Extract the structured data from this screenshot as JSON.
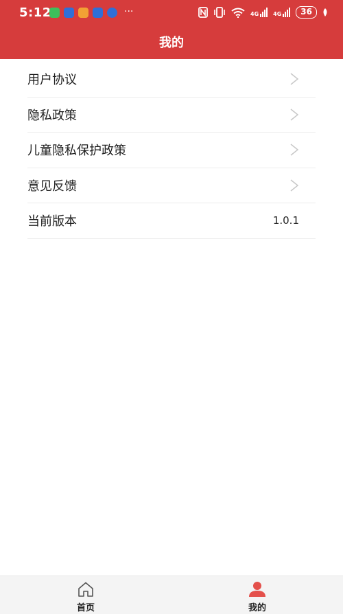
{
  "status_bar": {
    "time": "5:12",
    "more": "···",
    "network_label": "4G",
    "battery": "36"
  },
  "header": {
    "title": "我的"
  },
  "menu": {
    "items": [
      {
        "label": "用户协议"
      },
      {
        "label": "隐私政策"
      },
      {
        "label": "儿童隐私保护政策"
      },
      {
        "label": "意见反馈"
      }
    ],
    "version": {
      "label": "当前版本",
      "value": "1.0.1"
    }
  },
  "tabbar": {
    "home": {
      "label": "首页",
      "icon": "home-icon"
    },
    "mine": {
      "label": "我的",
      "icon": "user-icon"
    }
  },
  "colors": {
    "accent": "#d63c3c",
    "active_tab_icon": "#e4504b"
  }
}
